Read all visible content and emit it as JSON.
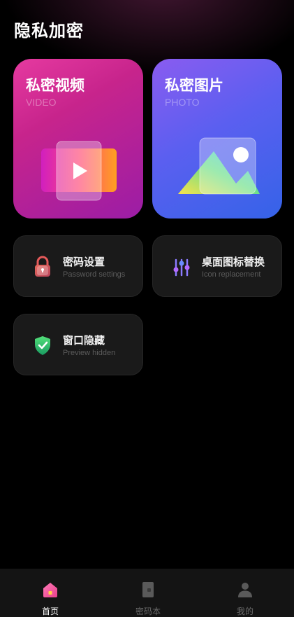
{
  "header": {
    "title": "隐私加密"
  },
  "cards": {
    "video": {
      "title": "私密视频",
      "subtitle": "VIDEO"
    },
    "photo": {
      "title": "私密图片",
      "subtitle": "PHOTO"
    }
  },
  "tools": [
    {
      "label": "密码设置",
      "sublabel": "Password settings",
      "icon": "lock-icon"
    },
    {
      "label": "桌面图标替换",
      "sublabel": "Icon replacement",
      "icon": "sliders-icon"
    },
    {
      "label": "窗口隐藏",
      "sublabel": "Preview  hidden",
      "icon": "shield-check-icon"
    }
  ],
  "tabbar": {
    "items": [
      {
        "label": "首页",
        "icon": "home-icon",
        "active": true
      },
      {
        "label": "密码本",
        "icon": "notebook-icon",
        "active": false
      },
      {
        "label": "我的",
        "icon": "user-icon",
        "active": false
      }
    ]
  },
  "colors": {
    "background": "#000000",
    "video_card": "#d42f96",
    "photo_card": "#5a5ff0",
    "tool_card": "#1a1a1a",
    "active_tab": "#ff5aa0"
  }
}
